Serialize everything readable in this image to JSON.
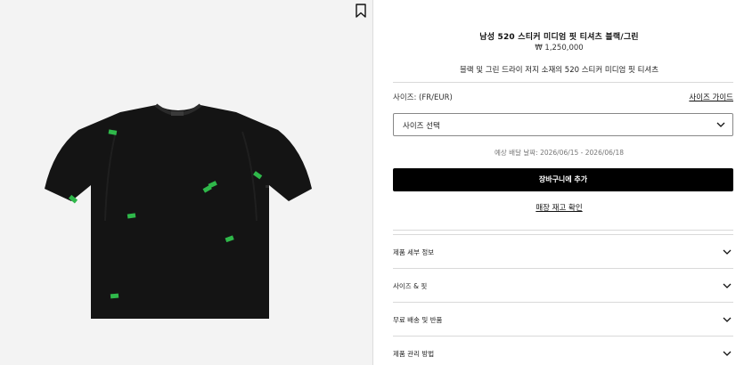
{
  "product": {
    "title": "남성 520 스티커 미디엄 핏 티셔츠 블랙/그린",
    "price": "₩ 1,250,000",
    "subtitle": "블랙 및 그린 드라이 저지 소재의 520 스티커 미디엄 핏 티셔츠",
    "image_alt": "black t-shirt with green stickers",
    "colors": {
      "shirt": "#141414",
      "sticker": "#2fb84a"
    }
  },
  "size": {
    "label": "사이즈: (FR/EUR)",
    "guide_link": "사이즈 가이드",
    "select_value": "사이즈 선택"
  },
  "delivery": {
    "text": "예상 배달 날짜: 2026/06/15 - 2026/06/18"
  },
  "actions": {
    "add_to_cart": "장바구니에 추가",
    "check_stock": "매장 재고 확인"
  },
  "accordion": [
    {
      "label": "제품 세부 정보"
    },
    {
      "label": "사이즈 & 핏"
    },
    {
      "label": "무료 배송 및 반품"
    },
    {
      "label": "제품 관리 방법"
    }
  ],
  "icons": {
    "bookmark": "bookmark-icon",
    "chevron": "chevron-down-icon"
  }
}
